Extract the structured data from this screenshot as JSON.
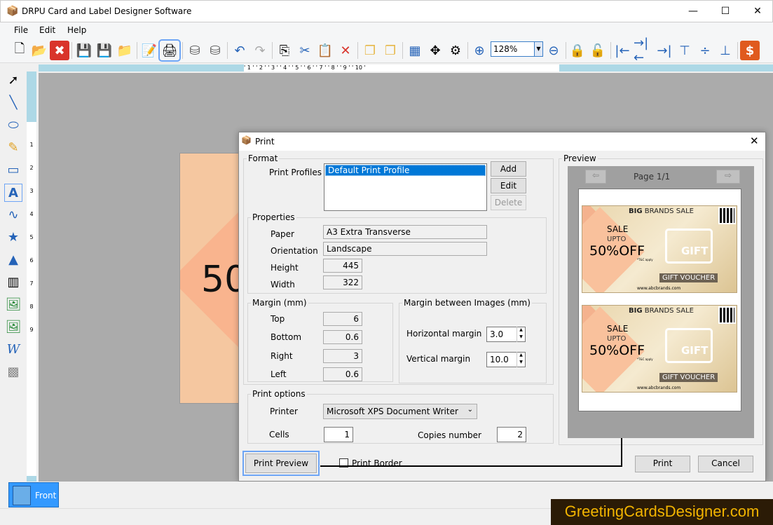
{
  "app": {
    "title": "DRPU Card and Label Designer Software"
  },
  "menu": [
    "File",
    "Edit",
    "Help"
  ],
  "toolbar": {
    "zoom": "128%",
    "icons": [
      "new-icon",
      "open-icon",
      "close-icon",
      "save-icon",
      "save-as-icon",
      "export-icon",
      "edit-icon",
      "print-icon",
      "database-add-icon",
      "database-icon",
      "undo-icon",
      "redo-icon",
      "copy-icon",
      "cut-icon",
      "paste-icon",
      "delete-icon",
      "bring-front-icon",
      "send-back-icon",
      "grid-icon",
      "move-center-icon",
      "settings-center-icon",
      "zoom-in-icon",
      "zoom-out-icon",
      "lock-icon",
      "unlock-icon",
      "align-left-icon",
      "align-center-icon",
      "align-right-icon",
      "align-top-icon",
      "align-middle-icon",
      "align-bottom-icon",
      "buy-icon"
    ]
  },
  "ruler": {
    "h": "' 1 ' ' 2 ' ' 3 ' ' 4 ' ' 5 ' ' 6 ' ' 7 ' ' 8 ' ' 9 ' ' 10 '",
    "v": [
      "1",
      "2",
      "3",
      "4",
      "5",
      "6",
      "7",
      "8",
      "9"
    ]
  },
  "canvas": {
    "card_text": "50"
  },
  "dialog": {
    "title": "Print",
    "format": {
      "legend": "Format",
      "profiles_label": "Print Profiles",
      "profiles": [
        "Default Print Profile"
      ],
      "add": "Add",
      "edit": "Edit",
      "delete": "Delete"
    },
    "properties": {
      "legend": "Properties",
      "paper_label": "Paper",
      "paper": "A3 Extra Transverse",
      "orientation_label": "Orientation",
      "orientation": "Landscape",
      "height_label": "Height",
      "height": "445",
      "width_label": "Width",
      "width": "322"
    },
    "margin": {
      "legend": "Margin (mm)",
      "top_label": "Top",
      "top": "6",
      "bottom_label": "Bottom",
      "bottom": "0.6",
      "right_label": "Right",
      "right": "3",
      "left_label": "Left",
      "left": "0.6"
    },
    "margin_images": {
      "legend": "Margin between Images (mm)",
      "h_label": "Horizontal margin",
      "h": "3.0",
      "v_label": "Vertical margin",
      "v": "10.0"
    },
    "print_options": {
      "legend": "Print options",
      "printer_label": "Printer",
      "printer": "Microsoft XPS Document Writer",
      "cells_label": "Cells",
      "cells": "1",
      "copies_label": "Copies number",
      "copies": "2"
    },
    "preview": {
      "legend": "Preview",
      "page": "Page 1/1"
    },
    "card": {
      "title_bold": "BIG",
      "title": "BRANDS SALE",
      "sale": "SALE",
      "upto": "UPTO",
      "off": "50%OFF",
      "tc": "*T&C apply",
      "gift": "GIFT",
      "voucher": "GIFT VOUCHER",
      "url": "www.abcbrands.com"
    },
    "print_preview": "Print Preview",
    "print_border": "Print Border",
    "print_border_checked": false,
    "print": "Print",
    "cancel": "Cancel"
  },
  "tabs": {
    "front": "Front"
  },
  "watermark": "GreetingCardsDesigner.com"
}
